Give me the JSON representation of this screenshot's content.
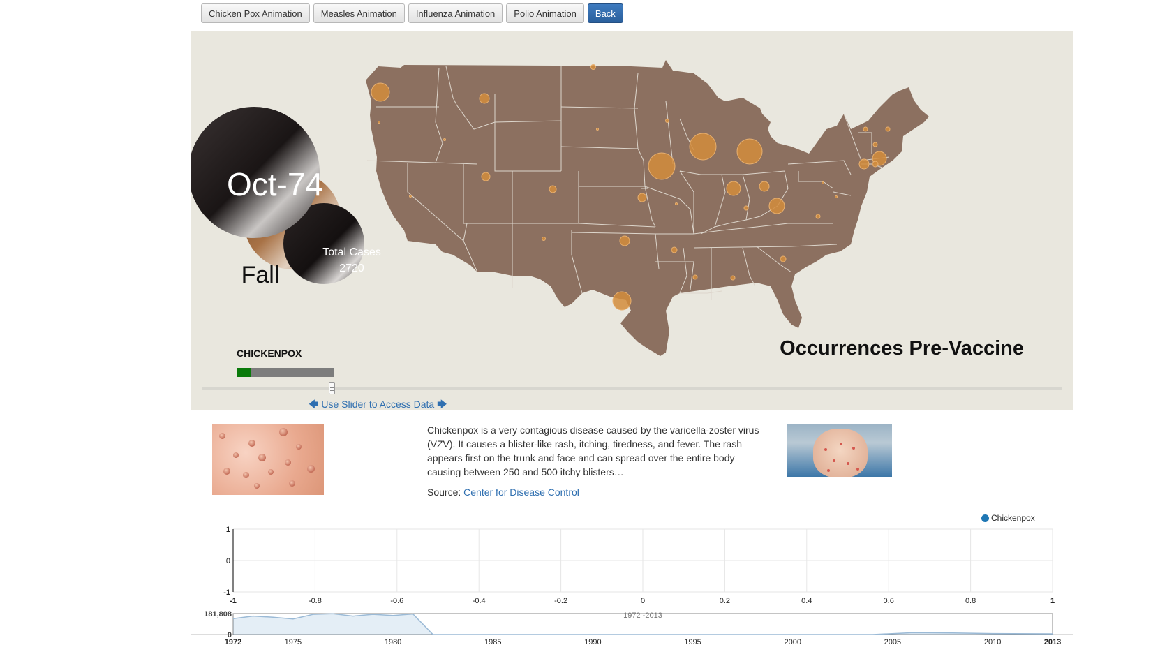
{
  "toolbar": {
    "buttons": [
      "Chicken Pox Animation",
      "Measles Animation",
      "Influenza Animation",
      "Polio Animation",
      "Back"
    ]
  },
  "animation": {
    "date": "Oct-74",
    "season": "Fall",
    "total_cases_label": "Total Cases",
    "total_cases": "2720",
    "disease": "CHICKENPOX",
    "progress": 0.14,
    "slider_hint": "Use Slider to Access Data",
    "map_title": "Occurrences Pre-Vaccine"
  },
  "colors": {
    "map_fill": "#8c7060",
    "bubble_fill": "#d28c3c",
    "panel_bg": "#e9e7de",
    "series": "#1f77b4",
    "progress_fill": "#0a7a0a"
  },
  "info": {
    "description": "Chickenpox is a very contagious disease caused by the varicella-zoster virus (VZV). It causes a blister-like rash, itching, tiredness, and fever. The rash appears first on the trunk and face and can spread over the entire body causing between 250 and 500 itchy blisters…",
    "source_label": "Source:",
    "source_link": "Center for Disease Control"
  },
  "chart_data": [
    {
      "type": "line",
      "series": [
        {
          "name": "Chickenpox",
          "values": []
        }
      ],
      "x_ticks": [
        "-1",
        "-0.8",
        "-0.6",
        "-0.4",
        "-0.2",
        "0",
        "0.2",
        "0.4",
        "0.6",
        "0.8",
        "1"
      ],
      "y_ticks": [
        "1",
        "0",
        "-1"
      ],
      "xlim": [
        -1,
        1
      ],
      "ylim": [
        -1,
        1
      ],
      "legend": "top-right",
      "grid": true
    },
    {
      "type": "area",
      "x": [
        1972,
        1973,
        1974,
        1975,
        1976,
        1977,
        1978,
        1979,
        1980,
        1981,
        1982,
        1983,
        1984,
        1985,
        1990,
        1995,
        2000,
        2004,
        2006,
        2008,
        2010,
        2013
      ],
      "values": [
        138000,
        160000,
        150000,
        135000,
        175000,
        180000,
        160000,
        175000,
        165000,
        178000,
        0,
        0,
        0,
        0,
        0,
        0,
        0,
        0,
        16000,
        14000,
        8000,
        6000
      ],
      "x_ticks": [
        "1972",
        "1975",
        "1980",
        "1985",
        "1990",
        "1995",
        "2000",
        "2005",
        "2010",
        "2013"
      ],
      "y_max_label": "181,808",
      "y_min_label": "0",
      "brush_label": "1972 -2013",
      "ylim": [
        0,
        181808
      ]
    }
  ]
}
